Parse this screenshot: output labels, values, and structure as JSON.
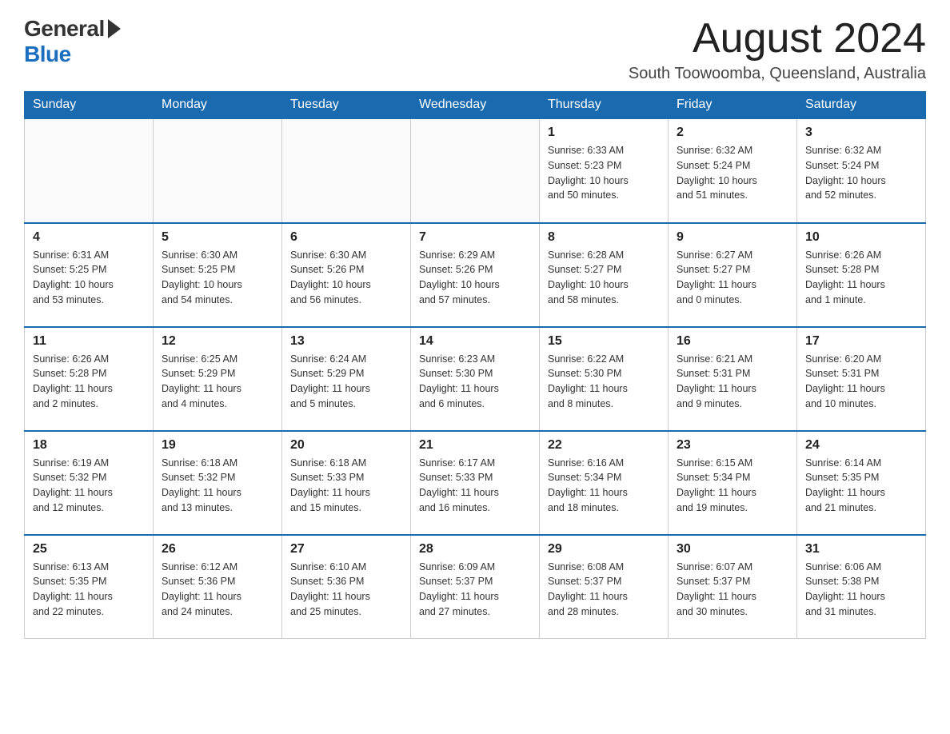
{
  "logo": {
    "general": "General",
    "blue": "Blue"
  },
  "title": {
    "month_year": "August 2024",
    "location": "South Toowoomba, Queensland, Australia"
  },
  "headers": [
    "Sunday",
    "Monday",
    "Tuesday",
    "Wednesday",
    "Thursday",
    "Friday",
    "Saturday"
  ],
  "weeks": [
    [
      {
        "day": "",
        "info": ""
      },
      {
        "day": "",
        "info": ""
      },
      {
        "day": "",
        "info": ""
      },
      {
        "day": "",
        "info": ""
      },
      {
        "day": "1",
        "info": "Sunrise: 6:33 AM\nSunset: 5:23 PM\nDaylight: 10 hours\nand 50 minutes."
      },
      {
        "day": "2",
        "info": "Sunrise: 6:32 AM\nSunset: 5:24 PM\nDaylight: 10 hours\nand 51 minutes."
      },
      {
        "day": "3",
        "info": "Sunrise: 6:32 AM\nSunset: 5:24 PM\nDaylight: 10 hours\nand 52 minutes."
      }
    ],
    [
      {
        "day": "4",
        "info": "Sunrise: 6:31 AM\nSunset: 5:25 PM\nDaylight: 10 hours\nand 53 minutes."
      },
      {
        "day": "5",
        "info": "Sunrise: 6:30 AM\nSunset: 5:25 PM\nDaylight: 10 hours\nand 54 minutes."
      },
      {
        "day": "6",
        "info": "Sunrise: 6:30 AM\nSunset: 5:26 PM\nDaylight: 10 hours\nand 56 minutes."
      },
      {
        "day": "7",
        "info": "Sunrise: 6:29 AM\nSunset: 5:26 PM\nDaylight: 10 hours\nand 57 minutes."
      },
      {
        "day": "8",
        "info": "Sunrise: 6:28 AM\nSunset: 5:27 PM\nDaylight: 10 hours\nand 58 minutes."
      },
      {
        "day": "9",
        "info": "Sunrise: 6:27 AM\nSunset: 5:27 PM\nDaylight: 11 hours\nand 0 minutes."
      },
      {
        "day": "10",
        "info": "Sunrise: 6:26 AM\nSunset: 5:28 PM\nDaylight: 11 hours\nand 1 minute."
      }
    ],
    [
      {
        "day": "11",
        "info": "Sunrise: 6:26 AM\nSunset: 5:28 PM\nDaylight: 11 hours\nand 2 minutes."
      },
      {
        "day": "12",
        "info": "Sunrise: 6:25 AM\nSunset: 5:29 PM\nDaylight: 11 hours\nand 4 minutes."
      },
      {
        "day": "13",
        "info": "Sunrise: 6:24 AM\nSunset: 5:29 PM\nDaylight: 11 hours\nand 5 minutes."
      },
      {
        "day": "14",
        "info": "Sunrise: 6:23 AM\nSunset: 5:30 PM\nDaylight: 11 hours\nand 6 minutes."
      },
      {
        "day": "15",
        "info": "Sunrise: 6:22 AM\nSunset: 5:30 PM\nDaylight: 11 hours\nand 8 minutes."
      },
      {
        "day": "16",
        "info": "Sunrise: 6:21 AM\nSunset: 5:31 PM\nDaylight: 11 hours\nand 9 minutes."
      },
      {
        "day": "17",
        "info": "Sunrise: 6:20 AM\nSunset: 5:31 PM\nDaylight: 11 hours\nand 10 minutes."
      }
    ],
    [
      {
        "day": "18",
        "info": "Sunrise: 6:19 AM\nSunset: 5:32 PM\nDaylight: 11 hours\nand 12 minutes."
      },
      {
        "day": "19",
        "info": "Sunrise: 6:18 AM\nSunset: 5:32 PM\nDaylight: 11 hours\nand 13 minutes."
      },
      {
        "day": "20",
        "info": "Sunrise: 6:18 AM\nSunset: 5:33 PM\nDaylight: 11 hours\nand 15 minutes."
      },
      {
        "day": "21",
        "info": "Sunrise: 6:17 AM\nSunset: 5:33 PM\nDaylight: 11 hours\nand 16 minutes."
      },
      {
        "day": "22",
        "info": "Sunrise: 6:16 AM\nSunset: 5:34 PM\nDaylight: 11 hours\nand 18 minutes."
      },
      {
        "day": "23",
        "info": "Sunrise: 6:15 AM\nSunset: 5:34 PM\nDaylight: 11 hours\nand 19 minutes."
      },
      {
        "day": "24",
        "info": "Sunrise: 6:14 AM\nSunset: 5:35 PM\nDaylight: 11 hours\nand 21 minutes."
      }
    ],
    [
      {
        "day": "25",
        "info": "Sunrise: 6:13 AM\nSunset: 5:35 PM\nDaylight: 11 hours\nand 22 minutes."
      },
      {
        "day": "26",
        "info": "Sunrise: 6:12 AM\nSunset: 5:36 PM\nDaylight: 11 hours\nand 24 minutes."
      },
      {
        "day": "27",
        "info": "Sunrise: 6:10 AM\nSunset: 5:36 PM\nDaylight: 11 hours\nand 25 minutes."
      },
      {
        "day": "28",
        "info": "Sunrise: 6:09 AM\nSunset: 5:37 PM\nDaylight: 11 hours\nand 27 minutes."
      },
      {
        "day": "29",
        "info": "Sunrise: 6:08 AM\nSunset: 5:37 PM\nDaylight: 11 hours\nand 28 minutes."
      },
      {
        "day": "30",
        "info": "Sunrise: 6:07 AM\nSunset: 5:37 PM\nDaylight: 11 hours\nand 30 minutes."
      },
      {
        "day": "31",
        "info": "Sunrise: 6:06 AM\nSunset: 5:38 PM\nDaylight: 11 hours\nand 31 minutes."
      }
    ]
  ]
}
